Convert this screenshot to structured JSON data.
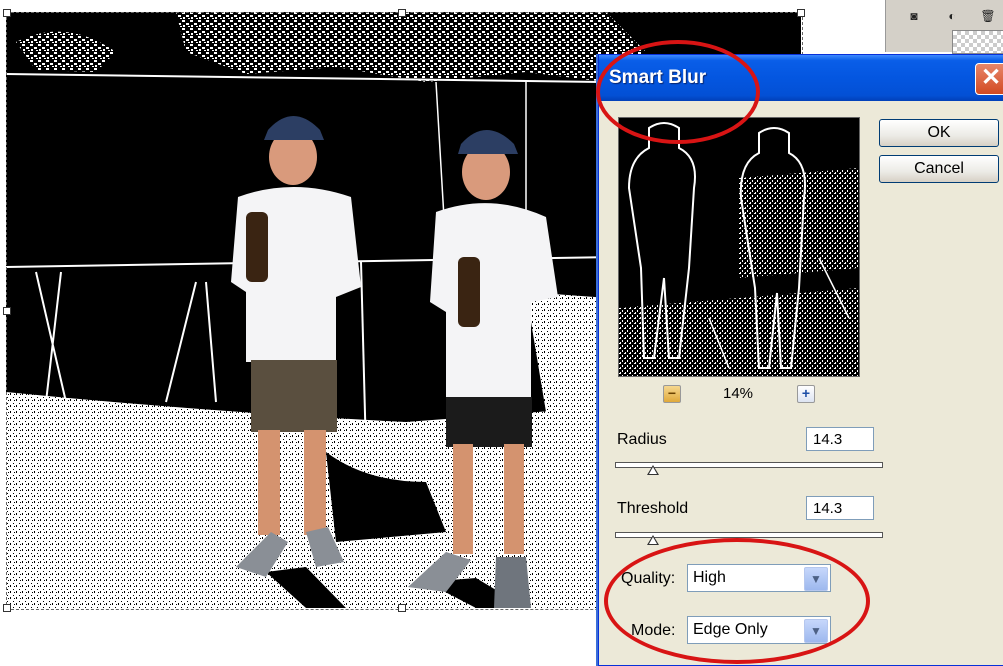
{
  "dialog": {
    "title": "Smart Blur",
    "close_glyph": "✕",
    "ok_label": "OK",
    "cancel_label": "Cancel",
    "zoom": {
      "out_glyph": "−",
      "in_glyph": "+",
      "level": "14%"
    },
    "radius": {
      "label": "Radius",
      "value": "14.3",
      "slider_fraction": 0.14
    },
    "threshold": {
      "label": "Threshold",
      "value": "14.3",
      "slider_fraction": 0.14
    },
    "quality": {
      "label": "Quality:",
      "selected": "High"
    },
    "mode": {
      "label": "Mode:",
      "selected": "Edge Only"
    }
  },
  "layers_panel": {
    "icons": [
      "new-layer-icon",
      "adjustment-layer-icon",
      "trash-icon"
    ]
  },
  "colors": {
    "title_bar": "#0456e0",
    "dialog_bg": "#ece9d8",
    "annotation_red": "#d81414"
  }
}
